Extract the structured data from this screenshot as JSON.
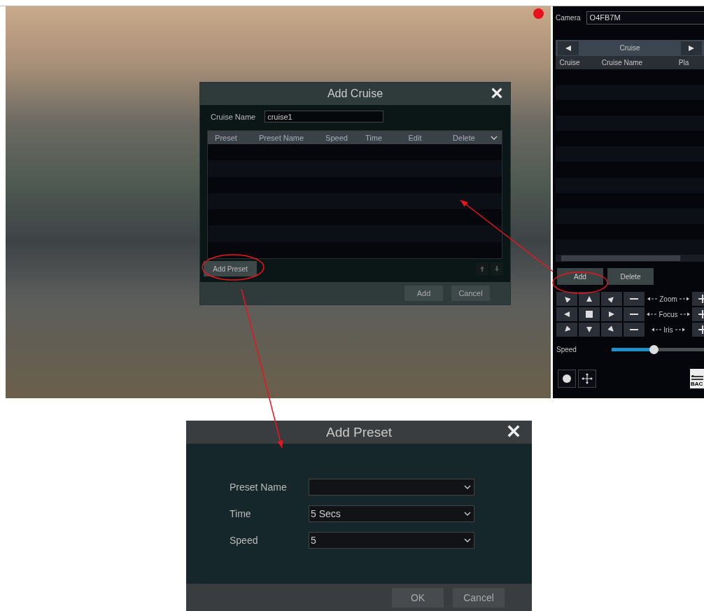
{
  "camera_view": {
    "recording": true
  },
  "ptz_panel": {
    "camera": {
      "label": "Camera",
      "value": "O4FB7M"
    },
    "cruise_table": {
      "title": "Cruise",
      "columns": [
        "Cruise",
        "Cruise Name",
        "Pla"
      ]
    },
    "buttons": [
      {
        "label": "Add",
        "highlighted": true
      },
      {
        "label": "Delete",
        "highlighted": false
      }
    ],
    "controls": [
      {
        "label": "Zoom"
      },
      {
        "label": "Focus"
      },
      {
        "label": "Iris"
      }
    ],
    "speed": {
      "label": "Speed",
      "level": 0.4
    },
    "back_label": "BAC"
  },
  "add_cruise_dialog": {
    "title": "Add Cruise",
    "name_label": "Cruise Name",
    "name_value": "cruise1",
    "columns": [
      "Preset",
      "Preset Name",
      "Speed",
      "Time",
      "Edit",
      "Delete"
    ],
    "add_preset_button": {
      "label": "Add Preset",
      "highlighted": true
    },
    "buttons": [
      "Add",
      "Cancel"
    ]
  },
  "add_preset_dialog": {
    "title": "Add Preset",
    "fields": [
      {
        "label": "Preset Name"
      },
      {
        "label": "Time",
        "value": "5 Secs"
      },
      {
        "label": "Speed",
        "value": "5"
      }
    ],
    "buttons": [
      "OK",
      "Cancel"
    ]
  }
}
